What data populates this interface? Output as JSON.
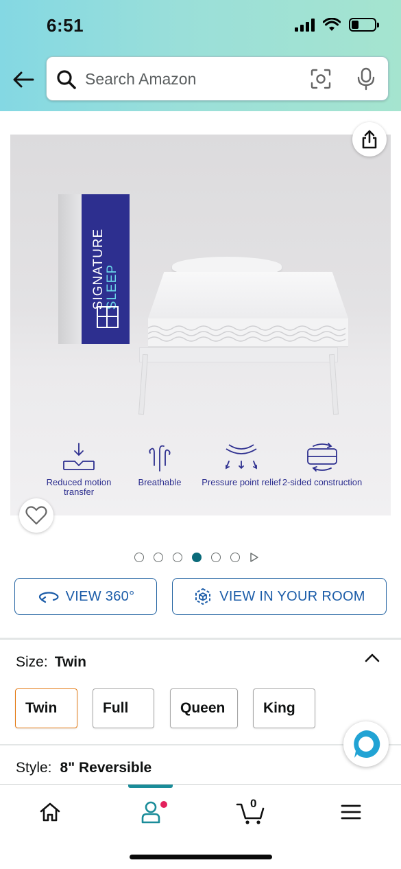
{
  "status_bar": {
    "time": "6:51",
    "battery_level": 0.3
  },
  "search": {
    "placeholder": "Search Amazon"
  },
  "product_image": {
    "brand_line1": "SIGNATURE",
    "brand_line2": "SLEEP",
    "features": [
      "Reduced motion transfer",
      "Breathable",
      "Pressure point relief",
      "2-sided construction"
    ],
    "carousel": {
      "total": 6,
      "active_index": 3
    }
  },
  "actions": {
    "view_360": "VIEW 360°",
    "view_in_room": "VIEW IN YOUR ROOM"
  },
  "size": {
    "label": "Size:",
    "selected": "Twin",
    "options": [
      "Twin",
      "Full",
      "Queen",
      "King"
    ]
  },
  "style": {
    "label": "Style:",
    "selected": "8\" Reversible"
  },
  "nav": {
    "cart_count": "0"
  },
  "colors": {
    "accent": "#0b6b7a",
    "link": "#1b5ca8",
    "selected_border": "#e47911",
    "brand_box": "#2d2f8f"
  }
}
